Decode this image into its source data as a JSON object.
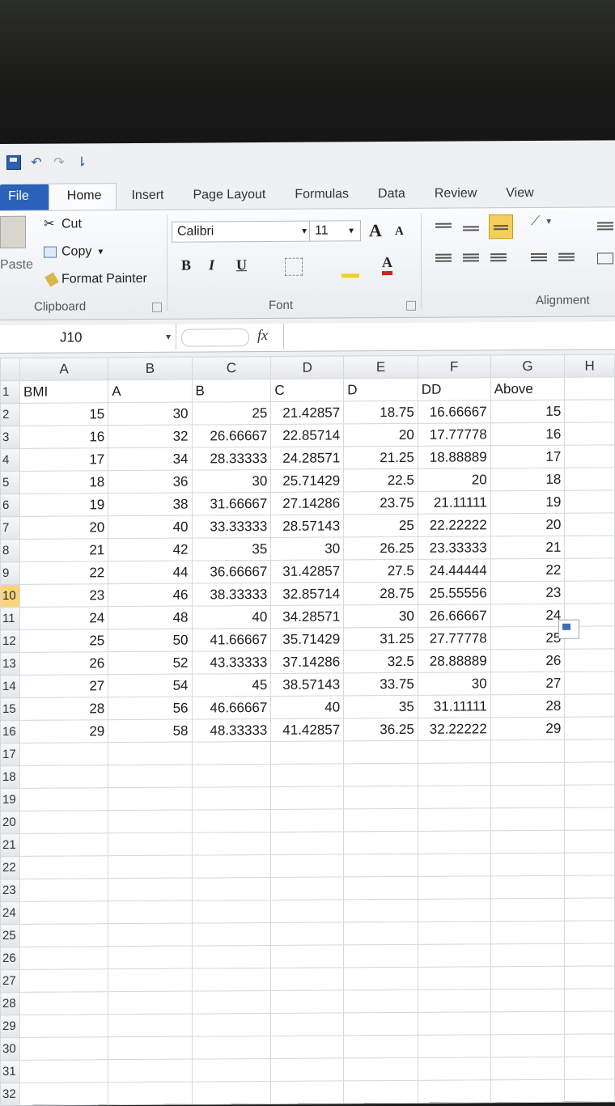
{
  "qat": {
    "undo_glyph": "↶",
    "redo_glyph": "↷",
    "customize_glyph": "⇂"
  },
  "tabs": [
    "File",
    "Home",
    "Insert",
    "Page Layout",
    "Formulas",
    "Data",
    "Review",
    "View"
  ],
  "ribbon": {
    "paste_label": "Paste",
    "cut_label": "Cut",
    "copy_label": "Copy",
    "format_painter_label": "Format Painter",
    "clipboard_group": "Clipboard",
    "font_name": "Calibri",
    "font_size": "11",
    "grow_font": "A",
    "shrink_font": "A",
    "bold": "B",
    "italic": "I",
    "underline": "U",
    "font_color_letter": "A",
    "font_group": "Font",
    "alignment_group": "Alignment"
  },
  "formula_bar": {
    "name_box": "J10",
    "fx_label": "fx",
    "formula": ""
  },
  "columns": [
    "A",
    "B",
    "C",
    "D",
    "E",
    "F",
    "G",
    "H"
  ],
  "rows": [
    {
      "n": "1",
      "cells": [
        "BMI",
        "A",
        "B",
        "C",
        "D",
        "DD",
        "Above",
        ""
      ]
    },
    {
      "n": "2",
      "cells": [
        "15",
        "30",
        "25",
        "21.42857",
        "18.75",
        "16.66667",
        "15",
        ""
      ]
    },
    {
      "n": "3",
      "cells": [
        "16",
        "32",
        "26.66667",
        "22.85714",
        "20",
        "17.77778",
        "16",
        ""
      ]
    },
    {
      "n": "4",
      "cells": [
        "17",
        "34",
        "28.33333",
        "24.28571",
        "21.25",
        "18.88889",
        "17",
        ""
      ]
    },
    {
      "n": "5",
      "cells": [
        "18",
        "36",
        "30",
        "25.71429",
        "22.5",
        "20",
        "18",
        ""
      ]
    },
    {
      "n": "6",
      "cells": [
        "19",
        "38",
        "31.66667",
        "27.14286",
        "23.75",
        "21.11111",
        "19",
        ""
      ]
    },
    {
      "n": "7",
      "cells": [
        "20",
        "40",
        "33.33333",
        "28.57143",
        "25",
        "22.22222",
        "20",
        ""
      ]
    },
    {
      "n": "8",
      "cells": [
        "21",
        "42",
        "35",
        "30",
        "26.25",
        "23.33333",
        "21",
        ""
      ]
    },
    {
      "n": "9",
      "cells": [
        "22",
        "44",
        "36.66667",
        "31.42857",
        "27.5",
        "24.44444",
        "22",
        ""
      ]
    },
    {
      "n": "10",
      "cells": [
        "23",
        "46",
        "38.33333",
        "32.85714",
        "28.75",
        "25.55556",
        "23",
        ""
      ]
    },
    {
      "n": "11",
      "cells": [
        "24",
        "48",
        "40",
        "34.28571",
        "30",
        "26.66667",
        "24",
        ""
      ]
    },
    {
      "n": "12",
      "cells": [
        "25",
        "50",
        "41.66667",
        "35.71429",
        "31.25",
        "27.77778",
        "25",
        ""
      ]
    },
    {
      "n": "13",
      "cells": [
        "26",
        "52",
        "43.33333",
        "37.14286",
        "32.5",
        "28.88889",
        "26",
        ""
      ]
    },
    {
      "n": "14",
      "cells": [
        "27",
        "54",
        "45",
        "38.57143",
        "33.75",
        "30",
        "27",
        ""
      ]
    },
    {
      "n": "15",
      "cells": [
        "28",
        "56",
        "46.66667",
        "40",
        "35",
        "31.11111",
        "28",
        ""
      ]
    },
    {
      "n": "16",
      "cells": [
        "29",
        "58",
        "48.33333",
        "41.42857",
        "36.25",
        "32.22222",
        "29",
        ""
      ]
    },
    {
      "n": "17",
      "cells": [
        "",
        "",
        "",
        "",
        "",
        "",
        "",
        ""
      ]
    },
    {
      "n": "18",
      "cells": [
        "",
        "",
        "",
        "",
        "",
        "",
        "",
        ""
      ]
    },
    {
      "n": "19",
      "cells": [
        "",
        "",
        "",
        "",
        "",
        "",
        "",
        ""
      ]
    },
    {
      "n": "20",
      "cells": [
        "",
        "",
        "",
        "",
        "",
        "",
        "",
        ""
      ]
    },
    {
      "n": "21",
      "cells": [
        "",
        "",
        "",
        "",
        "",
        "",
        "",
        ""
      ]
    },
    {
      "n": "22",
      "cells": [
        "",
        "",
        "",
        "",
        "",
        "",
        "",
        ""
      ]
    },
    {
      "n": "23",
      "cells": [
        "",
        "",
        "",
        "",
        "",
        "",
        "",
        ""
      ]
    },
    {
      "n": "24",
      "cells": [
        "",
        "",
        "",
        "",
        "",
        "",
        "",
        ""
      ]
    },
    {
      "n": "25",
      "cells": [
        "",
        "",
        "",
        "",
        "",
        "",
        "",
        ""
      ]
    },
    {
      "n": "26",
      "cells": [
        "",
        "",
        "",
        "",
        "",
        "",
        "",
        ""
      ]
    },
    {
      "n": "27",
      "cells": [
        "",
        "",
        "",
        "",
        "",
        "",
        "",
        ""
      ]
    },
    {
      "n": "28",
      "cells": [
        "",
        "",
        "",
        "",
        "",
        "",
        "",
        ""
      ]
    },
    {
      "n": "29",
      "cells": [
        "",
        "",
        "",
        "",
        "",
        "",
        "",
        ""
      ]
    },
    {
      "n": "30",
      "cells": [
        "",
        "",
        "",
        "",
        "",
        "",
        "",
        ""
      ]
    },
    {
      "n": "31",
      "cells": [
        "",
        "",
        "",
        "",
        "",
        "",
        "",
        ""
      ]
    },
    {
      "n": "32",
      "cells": [
        "",
        "",
        "",
        "",
        "",
        "",
        "",
        ""
      ]
    }
  ],
  "selected_row": "10",
  "colors": {
    "file_tab": "#2b62b8",
    "selected_header": "#f7d57f"
  }
}
